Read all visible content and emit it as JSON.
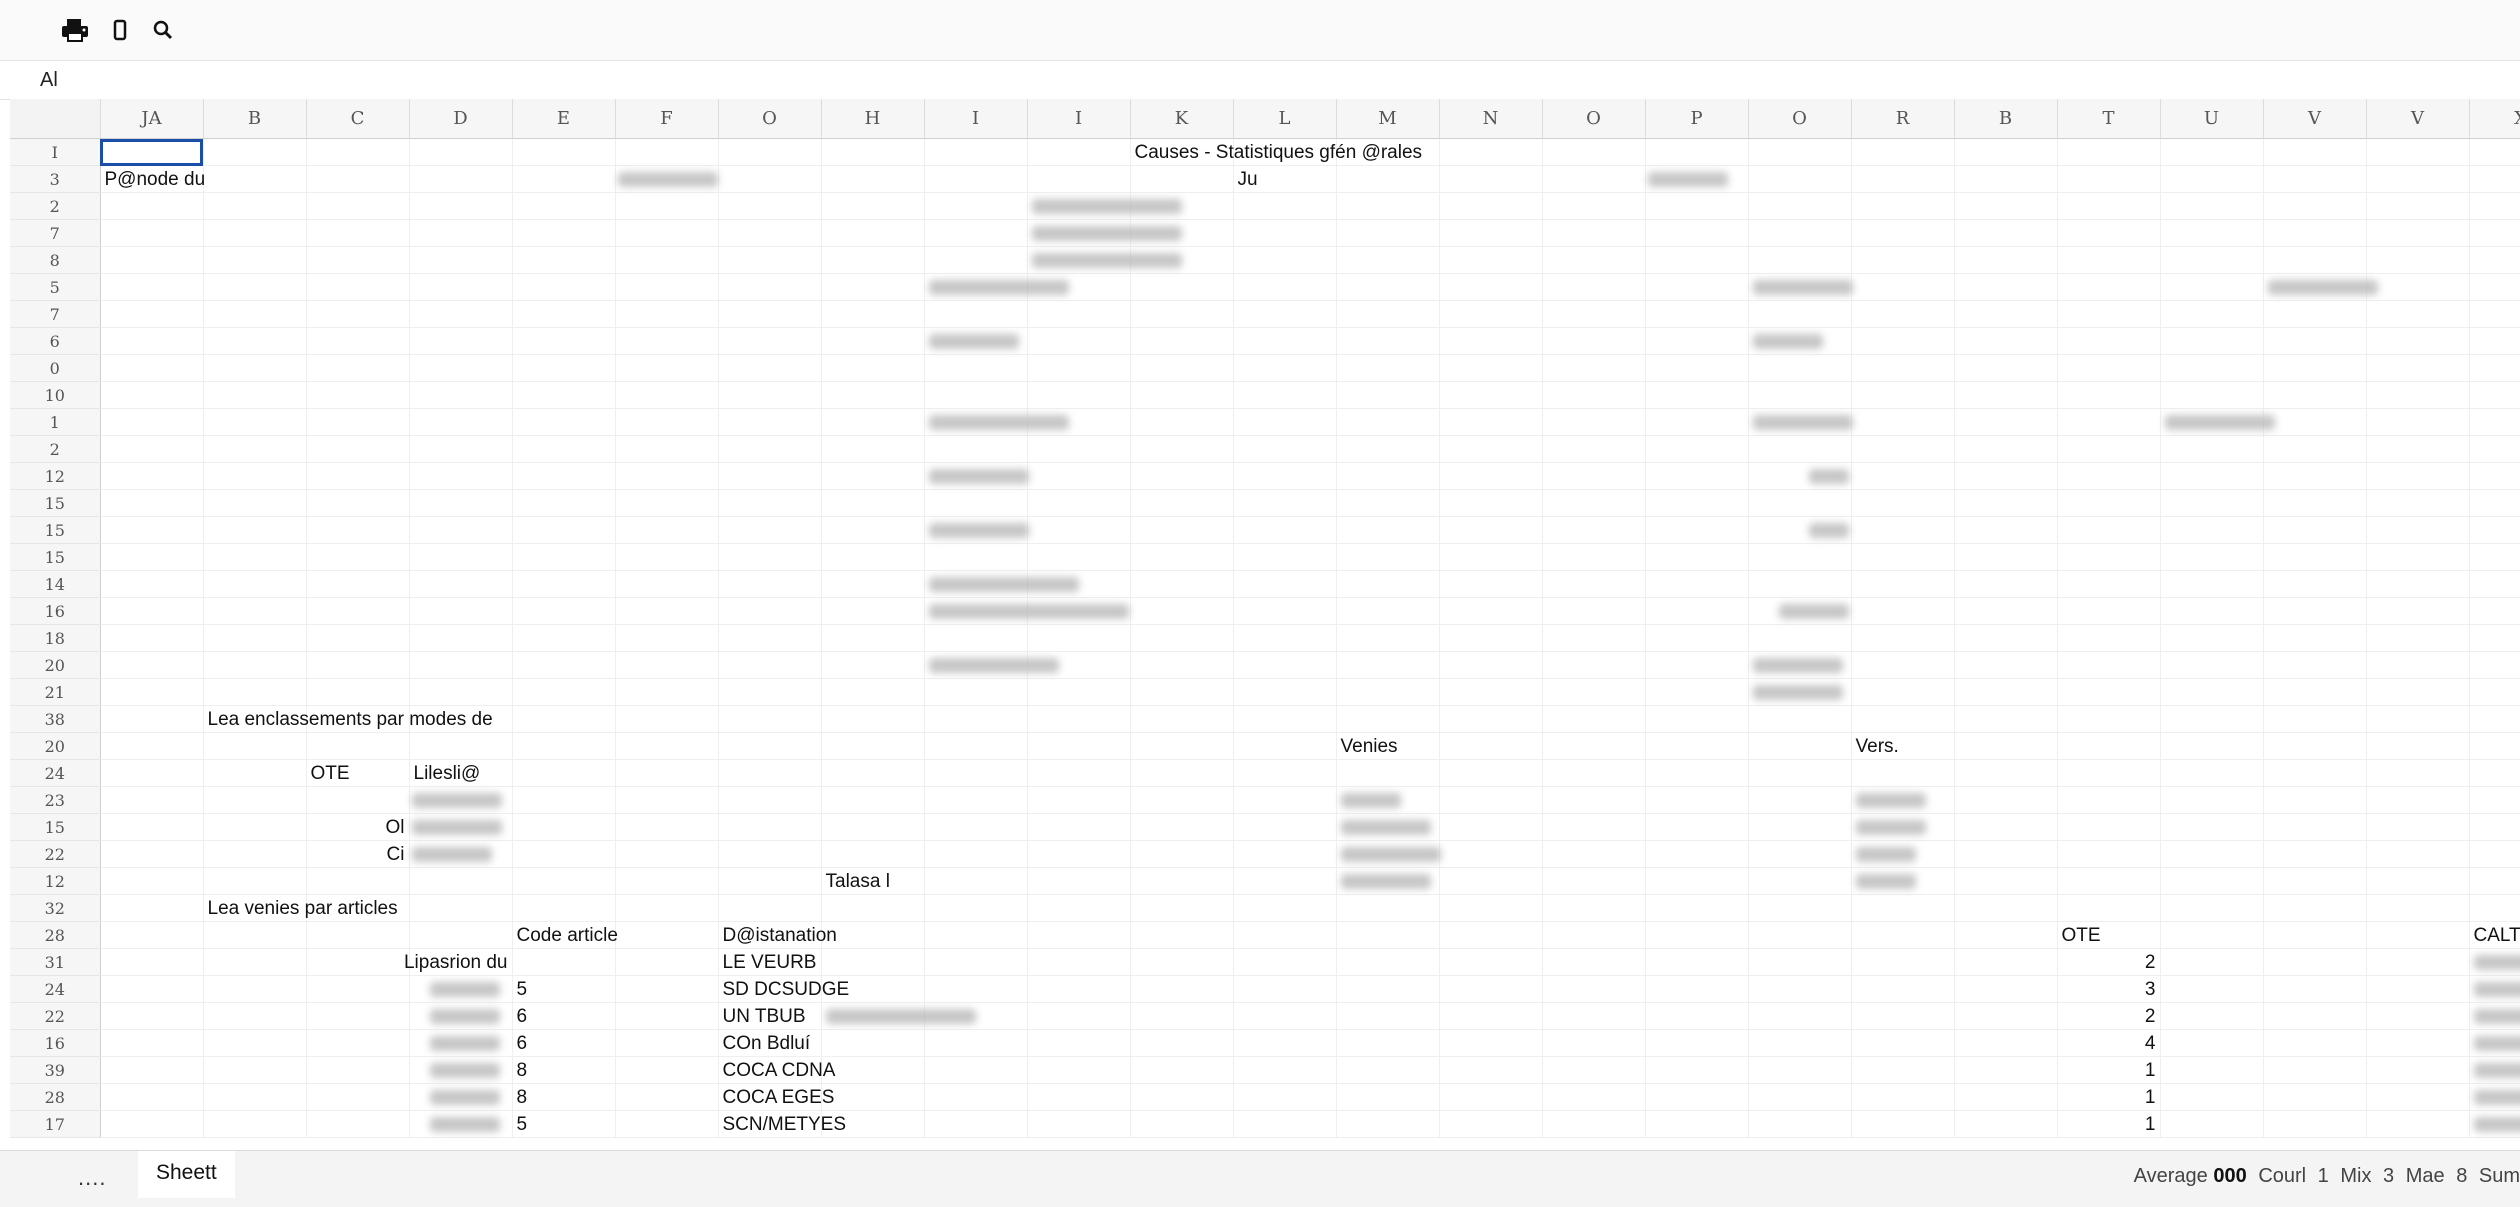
{
  "toolbar": {
    "icons": [
      "printer-icon",
      "clipboard-icon",
      "zoom-icon"
    ]
  },
  "namebox": {
    "ref": "Al"
  },
  "columns": [
    "JA",
    "B",
    "C",
    "D",
    "E",
    "F",
    "O",
    "H",
    "I",
    "I",
    "K",
    "L",
    "M",
    "N",
    "O",
    "P",
    "O",
    "R",
    "B",
    "T",
    "U",
    "V",
    "V",
    "X"
  ],
  "rows": [
    "I",
    "3",
    "2",
    "7",
    "8",
    "5",
    "7",
    "6",
    "0",
    "10",
    "1",
    "2",
    "12",
    "15",
    "15",
    "15",
    "14",
    "16",
    "18",
    "20",
    "21",
    "38",
    "20",
    "24",
    "23",
    "15",
    "22",
    "12",
    "32",
    "28",
    "31",
    "24",
    "22",
    "16",
    "39",
    "28",
    "17"
  ],
  "cells": {
    "title": "Causes -  Statistiques gfén @rales",
    "periode_label": "P@node du",
    "ju_label": "Ju",
    "enc_title": "Lea enclassements par modes de",
    "ote_label": "OTE",
    "libelle_label": "Lilesli@",
    "venies_label": "Venies",
    "vers_label": "Vers.",
    "ol_label": "Ol",
    "ci_label": "Ci",
    "talasa_label": "Talasa l",
    "articles_title": "Lea venies par articles",
    "code_article_header": "Code article",
    "designation_header": "D@istanation",
    "ote_header": "OTE",
    "calt_header": "CALTT",
    "lipasrion_label": "Lipasrion du"
  },
  "articles": [
    {
      "code_suffix": "",
      "designation": "LE VEURB",
      "qte": "2"
    },
    {
      "code_suffix": "5",
      "designation": "SD DCSUDGE",
      "qte": "3"
    },
    {
      "code_suffix": "6",
      "designation": "UN TBUB",
      "qte": "2"
    },
    {
      "code_suffix": "6",
      "designation": "COn Bdluí",
      "qte": "4"
    },
    {
      "code_suffix": "8",
      "designation": "COCA CDNA",
      "qte": "1"
    },
    {
      "code_suffix": "8",
      "designation": "COCA EGES",
      "qte": "1"
    },
    {
      "code_suffix": "5",
      "designation": "SCN/METYES",
      "qte": "1"
    }
  ],
  "bottom": {
    "menu": "....",
    "sheet_tab": "Sheett",
    "stats": {
      "average_label": "Average",
      "average_value": "000",
      "count_label": "Courl",
      "count_value": "1",
      "min_label": "Mix",
      "min_value": "3",
      "max_label": "Mae",
      "max_value": "8",
      "sum_label": "Sum"
    }
  }
}
